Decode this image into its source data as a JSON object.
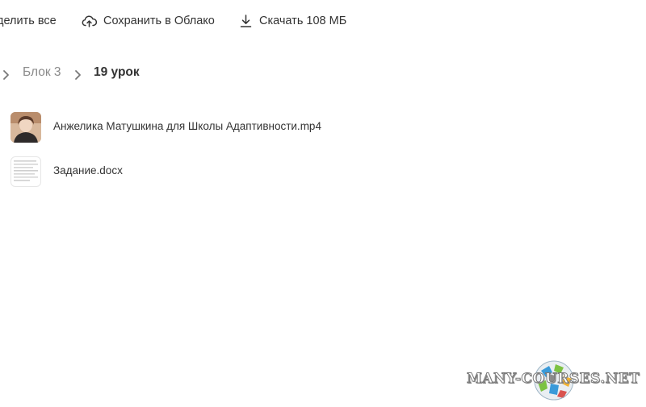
{
  "toolbar": {
    "select_all_label": "делить все",
    "save_label": "Сохранить в Облако",
    "download_label": "Скачать 108 МБ"
  },
  "breadcrumb": {
    "items": [
      {
        "label": "Блок 3"
      },
      {
        "label": "19 урок"
      }
    ]
  },
  "files": [
    {
      "name": "Анжелика Матушкина для Школы Адаптивности.mp4",
      "type": "video",
      "icon": "video-thumbnail"
    },
    {
      "name": "Задание.docx",
      "type": "document",
      "icon": "document-thumbnail"
    }
  ],
  "watermark": {
    "text": "MANY-COURSES.NET"
  },
  "colors": {
    "text": "#333333",
    "muted": "#8a8a8a",
    "background": "#ffffff"
  }
}
